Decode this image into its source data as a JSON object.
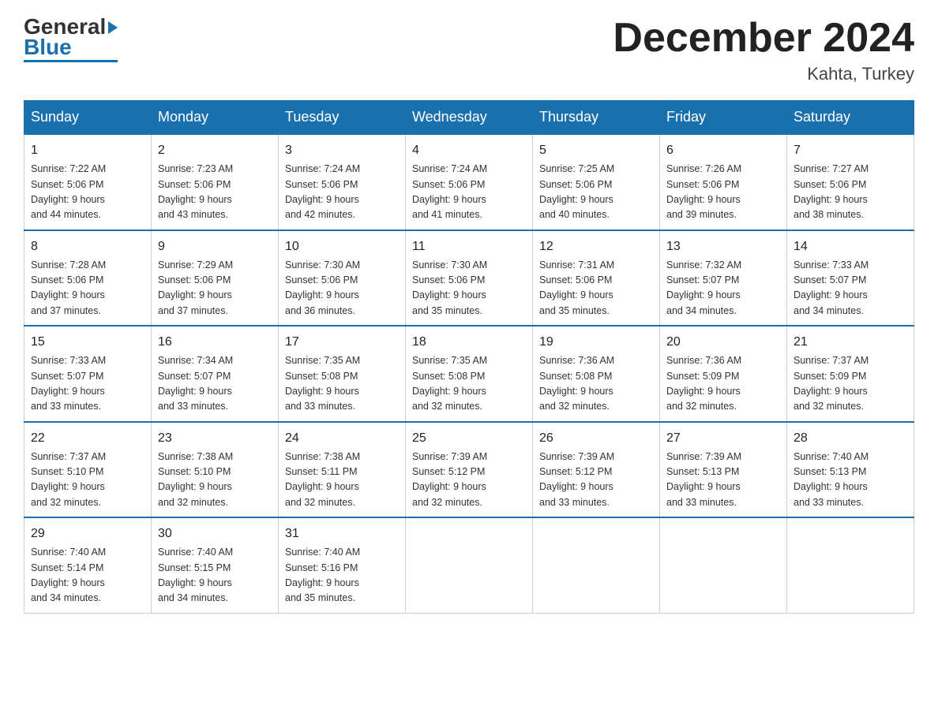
{
  "header": {
    "logo": {
      "general": "General",
      "blue": "Blue"
    },
    "title": "December 2024",
    "location": "Kahta, Turkey"
  },
  "days_of_week": [
    "Sunday",
    "Monday",
    "Tuesday",
    "Wednesday",
    "Thursday",
    "Friday",
    "Saturday"
  ],
  "weeks": [
    [
      {
        "num": "1",
        "sunrise": "7:22 AM",
        "sunset": "5:06 PM",
        "daylight": "9 hours and 44 minutes."
      },
      {
        "num": "2",
        "sunrise": "7:23 AM",
        "sunset": "5:06 PM",
        "daylight": "9 hours and 43 minutes."
      },
      {
        "num": "3",
        "sunrise": "7:24 AM",
        "sunset": "5:06 PM",
        "daylight": "9 hours and 42 minutes."
      },
      {
        "num": "4",
        "sunrise": "7:24 AM",
        "sunset": "5:06 PM",
        "daylight": "9 hours and 41 minutes."
      },
      {
        "num": "5",
        "sunrise": "7:25 AM",
        "sunset": "5:06 PM",
        "daylight": "9 hours and 40 minutes."
      },
      {
        "num": "6",
        "sunrise": "7:26 AM",
        "sunset": "5:06 PM",
        "daylight": "9 hours and 39 minutes."
      },
      {
        "num": "7",
        "sunrise": "7:27 AM",
        "sunset": "5:06 PM",
        "daylight": "9 hours and 38 minutes."
      }
    ],
    [
      {
        "num": "8",
        "sunrise": "7:28 AM",
        "sunset": "5:06 PM",
        "daylight": "9 hours and 37 minutes."
      },
      {
        "num": "9",
        "sunrise": "7:29 AM",
        "sunset": "5:06 PM",
        "daylight": "9 hours and 37 minutes."
      },
      {
        "num": "10",
        "sunrise": "7:30 AM",
        "sunset": "5:06 PM",
        "daylight": "9 hours and 36 minutes."
      },
      {
        "num": "11",
        "sunrise": "7:30 AM",
        "sunset": "5:06 PM",
        "daylight": "9 hours and 35 minutes."
      },
      {
        "num": "12",
        "sunrise": "7:31 AM",
        "sunset": "5:06 PM",
        "daylight": "9 hours and 35 minutes."
      },
      {
        "num": "13",
        "sunrise": "7:32 AM",
        "sunset": "5:07 PM",
        "daylight": "9 hours and 34 minutes."
      },
      {
        "num": "14",
        "sunrise": "7:33 AM",
        "sunset": "5:07 PM",
        "daylight": "9 hours and 34 minutes."
      }
    ],
    [
      {
        "num": "15",
        "sunrise": "7:33 AM",
        "sunset": "5:07 PM",
        "daylight": "9 hours and 33 minutes."
      },
      {
        "num": "16",
        "sunrise": "7:34 AM",
        "sunset": "5:07 PM",
        "daylight": "9 hours and 33 minutes."
      },
      {
        "num": "17",
        "sunrise": "7:35 AM",
        "sunset": "5:08 PM",
        "daylight": "9 hours and 33 minutes."
      },
      {
        "num": "18",
        "sunrise": "7:35 AM",
        "sunset": "5:08 PM",
        "daylight": "9 hours and 32 minutes."
      },
      {
        "num": "19",
        "sunrise": "7:36 AM",
        "sunset": "5:08 PM",
        "daylight": "9 hours and 32 minutes."
      },
      {
        "num": "20",
        "sunrise": "7:36 AM",
        "sunset": "5:09 PM",
        "daylight": "9 hours and 32 minutes."
      },
      {
        "num": "21",
        "sunrise": "7:37 AM",
        "sunset": "5:09 PM",
        "daylight": "9 hours and 32 minutes."
      }
    ],
    [
      {
        "num": "22",
        "sunrise": "7:37 AM",
        "sunset": "5:10 PM",
        "daylight": "9 hours and 32 minutes."
      },
      {
        "num": "23",
        "sunrise": "7:38 AM",
        "sunset": "5:10 PM",
        "daylight": "9 hours and 32 minutes."
      },
      {
        "num": "24",
        "sunrise": "7:38 AM",
        "sunset": "5:11 PM",
        "daylight": "9 hours and 32 minutes."
      },
      {
        "num": "25",
        "sunrise": "7:39 AM",
        "sunset": "5:12 PM",
        "daylight": "9 hours and 32 minutes."
      },
      {
        "num": "26",
        "sunrise": "7:39 AM",
        "sunset": "5:12 PM",
        "daylight": "9 hours and 33 minutes."
      },
      {
        "num": "27",
        "sunrise": "7:39 AM",
        "sunset": "5:13 PM",
        "daylight": "9 hours and 33 minutes."
      },
      {
        "num": "28",
        "sunrise": "7:40 AM",
        "sunset": "5:13 PM",
        "daylight": "9 hours and 33 minutes."
      }
    ],
    [
      {
        "num": "29",
        "sunrise": "7:40 AM",
        "sunset": "5:14 PM",
        "daylight": "9 hours and 34 minutes."
      },
      {
        "num": "30",
        "sunrise": "7:40 AM",
        "sunset": "5:15 PM",
        "daylight": "9 hours and 34 minutes."
      },
      {
        "num": "31",
        "sunrise": "7:40 AM",
        "sunset": "5:16 PM",
        "daylight": "9 hours and 35 minutes."
      },
      null,
      null,
      null,
      null
    ]
  ],
  "labels": {
    "sunrise": "Sunrise:",
    "sunset": "Sunset:",
    "daylight": "Daylight:"
  }
}
